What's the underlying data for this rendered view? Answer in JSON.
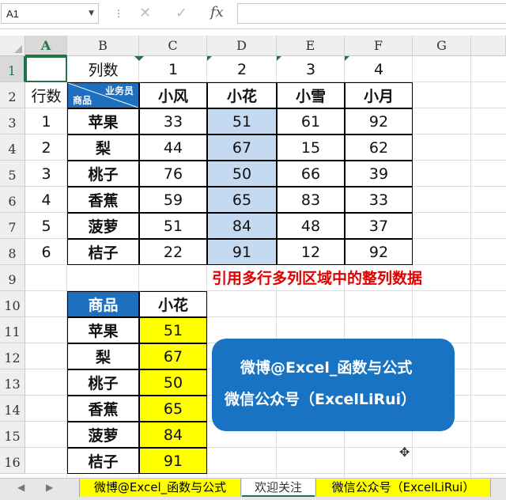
{
  "formula_bar": {
    "name_box": "A1",
    "cancel_icon": "✕",
    "enter_icon": "✓",
    "fx_label": "fx",
    "formula": ""
  },
  "columns": [
    "A",
    "B",
    "C",
    "D",
    "E",
    "F",
    "G"
  ],
  "rows": [
    "1",
    "2",
    "3",
    "4",
    "5",
    "6",
    "7",
    "8",
    "9",
    "10",
    "11",
    "12",
    "13",
    "14",
    "15",
    "16"
  ],
  "top_table": {
    "col_count_label": "列数",
    "col_numbers": [
      "1",
      "2",
      "3",
      "4"
    ],
    "row_count_label": "行数",
    "row_numbers": [
      "1",
      "2",
      "3",
      "4",
      "5",
      "6"
    ],
    "diag_header_top": "业务员",
    "diag_header_bottom": "商品",
    "persons": [
      "小风",
      "小花",
      "小雪",
      "小月"
    ],
    "products": [
      "苹果",
      "梨",
      "桃子",
      "香蕉",
      "菠萝",
      "桔子"
    ],
    "values": [
      [
        "33",
        "51",
        "61",
        "92"
      ],
      [
        "44",
        "67",
        "15",
        "62"
      ],
      [
        "76",
        "50",
        "66",
        "39"
      ],
      [
        "59",
        "65",
        "83",
        "33"
      ],
      [
        "51",
        "84",
        "48",
        "37"
      ],
      [
        "22",
        "91",
        "12",
        "92"
      ]
    ]
  },
  "note": "引用多行多列区域中的整列数据",
  "result_table": {
    "header_product": "商品",
    "header_person": "小花",
    "products": [
      "苹果",
      "梨",
      "桃子",
      "香蕉",
      "菠萝",
      "桔子"
    ],
    "values": [
      "51",
      "67",
      "50",
      "65",
      "84",
      "91"
    ]
  },
  "banner": {
    "line1": "微博@Excel_函数与公式",
    "line2": "微信公众号（ExcelLiRui）"
  },
  "sheet_tabs": [
    "微博@Excel_函数与公式",
    "欢迎关注",
    "微信公众号（ExcelLiRui）"
  ],
  "colors": {
    "accent_green": "#217346",
    "header_blue": "#1f6fbf",
    "highlight_blue": "#c5d9f1",
    "highlight_yellow": "#ffff00",
    "note_red": "#e00000"
  }
}
